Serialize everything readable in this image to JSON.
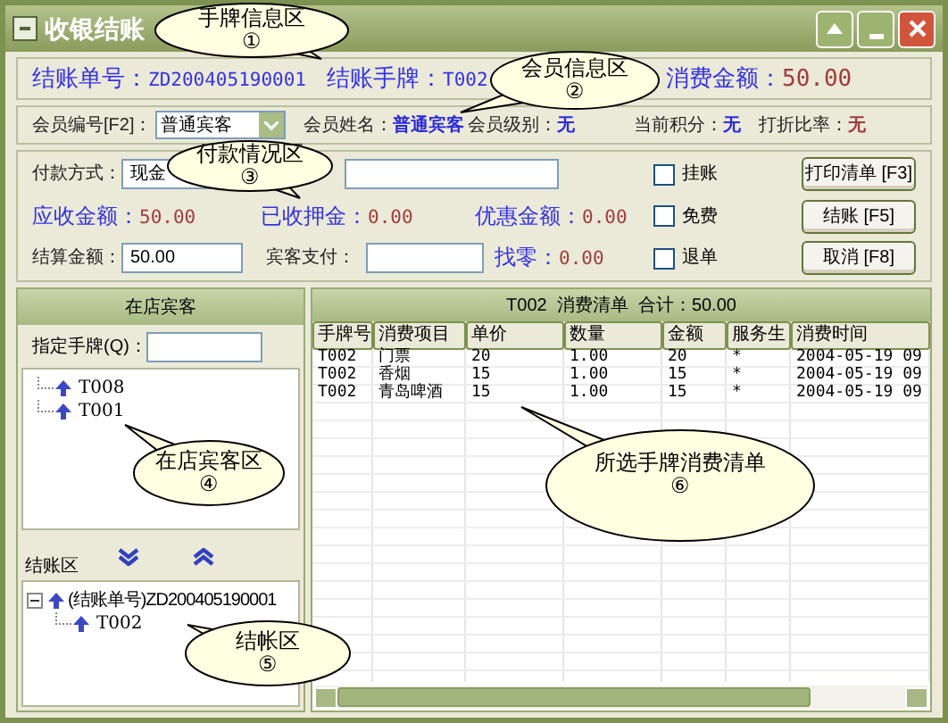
{
  "window": {
    "title": "收银结账"
  },
  "header": [
    {
      "label": "结账单号：",
      "value": "ZD200405190001",
      "kind": "code"
    },
    {
      "label": "结账手牌：",
      "value": "T002",
      "kind": "code"
    },
    {
      "label": "消费金额：",
      "value": "50.00",
      "kind": "amount"
    }
  ],
  "member": {
    "id_label": "会员编号[F2]：",
    "id_value": "普通宾客",
    "fields": [
      {
        "label": "会员姓名：",
        "value": "普通宾客",
        "kind": "info"
      },
      {
        "label": "会员级别：",
        "value": "无",
        "kind": "info"
      },
      {
        "label": "当前积分：",
        "value": "无",
        "kind": "info"
      },
      {
        "label": "打折比率：",
        "value": "无",
        "kind": "alert"
      }
    ]
  },
  "payment": {
    "method_label": "付款方式：",
    "method_value": "现金",
    "amounts": [
      {
        "label": "应收金额：",
        "value": "50.00"
      },
      {
        "label": "已收押金：",
        "value": "0.00"
      },
      {
        "label": "优惠金额：",
        "value": "0.00"
      }
    ],
    "settle_label": "结算金额：",
    "settle_value": "50.00",
    "paid_label": "宾客支付：",
    "change_label": "找零：",
    "change_value": "0.00",
    "options": [
      {
        "label": "挂账",
        "checked": false
      },
      {
        "label": "免费",
        "checked": false
      },
      {
        "label": "退单",
        "checked": false
      }
    ],
    "buttons": [
      "打印清单 [F3]",
      "结账 [F5]",
      "取消 [F8]"
    ]
  },
  "guests": {
    "title": "在店宾客",
    "filter_label": "指定手牌(Q)：",
    "items": [
      "T008",
      "T001"
    ]
  },
  "checkout": {
    "title": "结账区",
    "items": [
      {
        "label": "(结账单号)ZD200405190001",
        "expanded": true,
        "children": [
          {
            "label": "T002"
          }
        ]
      }
    ]
  },
  "bill": {
    "title": "T002  消费清单  合计：50.00",
    "columns": [
      "手牌号",
      "消费项目",
      "单价",
      "数量",
      "金额",
      "服务生",
      "消费时间"
    ],
    "rows": [
      [
        "T002",
        "门票",
        "20",
        "1.00",
        "20",
        "*",
        "2004-05-19 09"
      ],
      [
        "T002",
        "香烟",
        "15",
        "1.00",
        "15",
        "*",
        "2004-05-19 09"
      ],
      [
        "T002",
        "青岛啤酒",
        "15",
        "1.00",
        "15",
        "*",
        "2004-05-19 09"
      ]
    ]
  },
  "callouts": [
    {
      "text": "手牌信息区",
      "number": "①"
    },
    {
      "text": "会员信息区",
      "number": "②"
    },
    {
      "text": "付款情况区",
      "number": "③"
    },
    {
      "text": "在店宾客区",
      "number": "④"
    },
    {
      "text": "结帐区",
      "number": "⑤"
    },
    {
      "text": "所选手牌消费清单",
      "number": "⑥"
    }
  ]
}
